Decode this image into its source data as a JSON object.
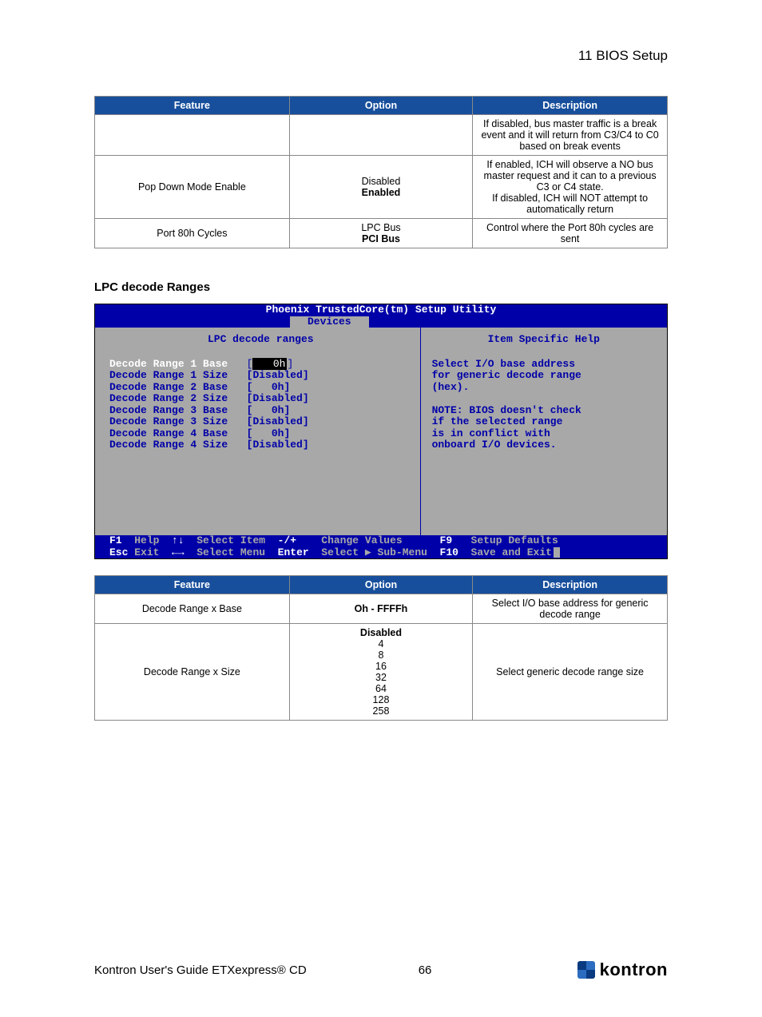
{
  "header": {
    "section": "11 BIOS Setup"
  },
  "table1": {
    "headers": [
      "Feature",
      "Option",
      "Description"
    ],
    "rows": [
      {
        "feature": "",
        "option": "",
        "description": "If disabled, bus master traffic is a break event and it will return from C3/C4 to C0 based on break events"
      },
      {
        "feature": "Pop Down Mode Enable",
        "option_lines": [
          "Disabled",
          "Enabled"
        ],
        "option_bold_index": 1,
        "description": "If enabled, ICH will observe a NO bus master request and it can to a previous C3 or C4 state.\nIf disabled, ICH will NOT attempt to automatically return"
      },
      {
        "feature": "Port 80h Cycles",
        "option_lines": [
          "LPC Bus",
          "PCI Bus"
        ],
        "option_bold_index": 1,
        "description": "Control where the Port 80h cycles are sent"
      }
    ]
  },
  "subheading": "LPC decode Ranges",
  "bios": {
    "title": "Phoenix TrustedCore(tm) Setup Utility",
    "tab": "Devices",
    "left_heading": "LPC decode ranges",
    "right_heading": "Item Specific Help",
    "items": [
      {
        "label": "Decode Range 1 Base",
        "value": "0h",
        "selected": true
      },
      {
        "label": "Decode Range 1 Size",
        "value": "Disabled"
      },
      {
        "label": "Decode Range 2 Base",
        "value": "0h"
      },
      {
        "label": "Decode Range 2 Size",
        "value": "Disabled"
      },
      {
        "label": "Decode Range 3 Base",
        "value": "0h"
      },
      {
        "label": "Decode Range 3 Size",
        "value": "Disabled"
      },
      {
        "label": "Decode Range 4 Base",
        "value": "0h"
      },
      {
        "label": "Decode Range 4 Size",
        "value": "Disabled"
      }
    ],
    "help_lines": [
      "Select I/O base address",
      "for generic decode range",
      "(hex).",
      "",
      "NOTE: BIOS doesn't check",
      "if the selected range",
      "is in conflict with",
      "onboard I/O devices."
    ],
    "footer": {
      "l1": {
        "k1": "F1",
        "t1": "Help",
        "k2": "↑↓",
        "t2": "Select Item",
        "k3": "-/+",
        "t3": "Change Values",
        "k4": "F9",
        "t4": "Setup Defaults"
      },
      "l2": {
        "k1": "Esc",
        "t1": "Exit",
        "k2": "←→",
        "t2": "Select Menu",
        "k3": "Enter",
        "t3": "Select ▶ Sub-Menu",
        "k4": "F10",
        "t4": "Save and Exit"
      }
    }
  },
  "table2": {
    "headers": [
      "Feature",
      "Option",
      "Description"
    ],
    "rows": [
      {
        "feature": "Decode Range x Base",
        "option_lines": [
          "Oh - FFFFh"
        ],
        "option_bold_index": 0,
        "description": "Select I/O base address for generic decode range"
      },
      {
        "feature": "Decode Range x Size",
        "option_lines": [
          "Disabled",
          "4",
          "8",
          "16",
          "32",
          "64",
          "128",
          "258"
        ],
        "option_bold_index": 0,
        "description": "Select generic decode range size"
      }
    ]
  },
  "page_footer": {
    "left": "Kontron User's Guide ETXexpress® CD",
    "page": "66",
    "brand": "kontron"
  }
}
